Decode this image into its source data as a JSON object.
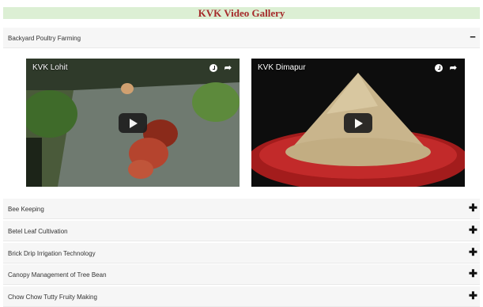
{
  "page_title": "KVK Video Gallery",
  "sections": [
    {
      "label": "Backyard Poultry Farming",
      "toggle": "−",
      "videos": [
        {
          "title": "KVK Lohit",
          "icon": "play-icon"
        },
        {
          "title": "KVK Dimapur",
          "icon": "play-icon"
        }
      ]
    },
    {
      "label": "Bee Keeping",
      "toggle": "✚"
    },
    {
      "label": "Betel Leaf Cultivation",
      "toggle": "✚"
    },
    {
      "label": "Brick Drip Irrigation Technology",
      "toggle": "✚"
    },
    {
      "label": "Canopy Management of Tree Bean",
      "toggle": "✚"
    },
    {
      "label": "Chow Chow Tutty Fruity Making",
      "toggle": "✚"
    }
  ],
  "colors": {
    "title_text": "#a52a2a",
    "title_bg": "#dcefd4",
    "header_bg": "#f6f6f6"
  }
}
